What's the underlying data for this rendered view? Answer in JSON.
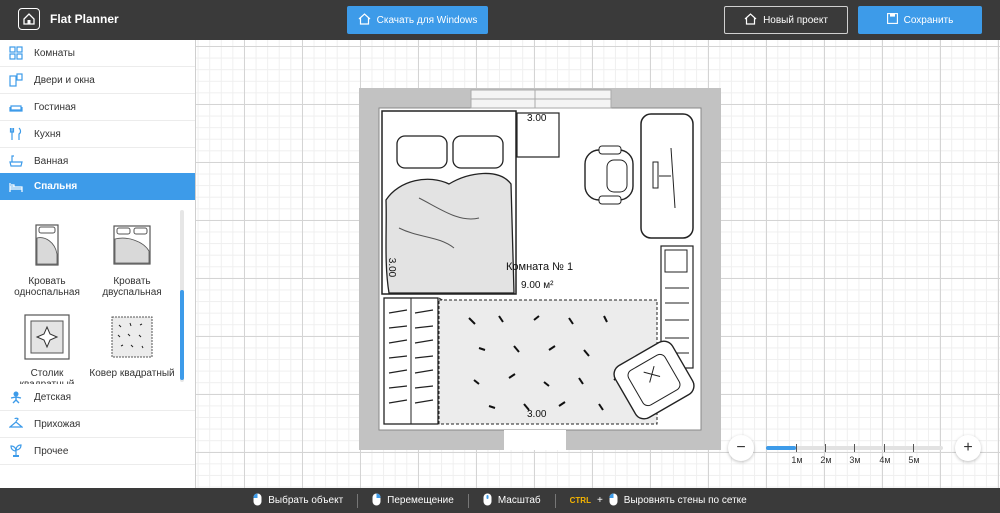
{
  "app": {
    "title": "Flat Planner"
  },
  "header": {
    "download_label": "Скачать для Windows",
    "new_project_label": "Новый проект",
    "save_label": "Сохранить"
  },
  "sidebar": {
    "categories": [
      {
        "label": "Комнаты",
        "icon": "rooms-icon"
      },
      {
        "label": "Двери и окна",
        "icon": "doors-windows-icon"
      },
      {
        "label": "Гостиная",
        "icon": "sofa-icon"
      },
      {
        "label": "Кухня",
        "icon": "cutlery-icon"
      },
      {
        "label": "Ванная",
        "icon": "bathtub-icon"
      },
      {
        "label": "Спальня",
        "icon": "bed-icon"
      },
      {
        "label": "Детская",
        "icon": "kids-icon"
      },
      {
        "label": "Прихожая",
        "icon": "hanger-icon"
      },
      {
        "label": "Прочее",
        "icon": "plant-icon"
      }
    ],
    "active_category": "Спальня",
    "items": [
      {
        "label": "Кровать односпальная"
      },
      {
        "label": "Кровать двуспальная"
      },
      {
        "label": "Столик квадратный"
      },
      {
        "label": "Ковер квадратный"
      }
    ]
  },
  "plan": {
    "room_name": "Комната №  1",
    "room_area": "9.00 м²",
    "dimension_top": "3.00",
    "dimension_left": "3.00",
    "dimension_bottom": "3.00"
  },
  "zoom": {
    "labels": [
      "1м",
      "2м",
      "3м",
      "4м",
      "5м"
    ],
    "level_fraction": 0.17
  },
  "footer": {
    "hints": [
      "Выбрать объект",
      "Перемещение",
      "Масштаб"
    ],
    "ctrl_key": "CTRL",
    "plus": "+",
    "align_hint": "Выровнять стены по сетке"
  },
  "colors": {
    "accent": "#3d9be9",
    "header_bg": "#3a3a3a",
    "wall": "#c2c2c2"
  }
}
